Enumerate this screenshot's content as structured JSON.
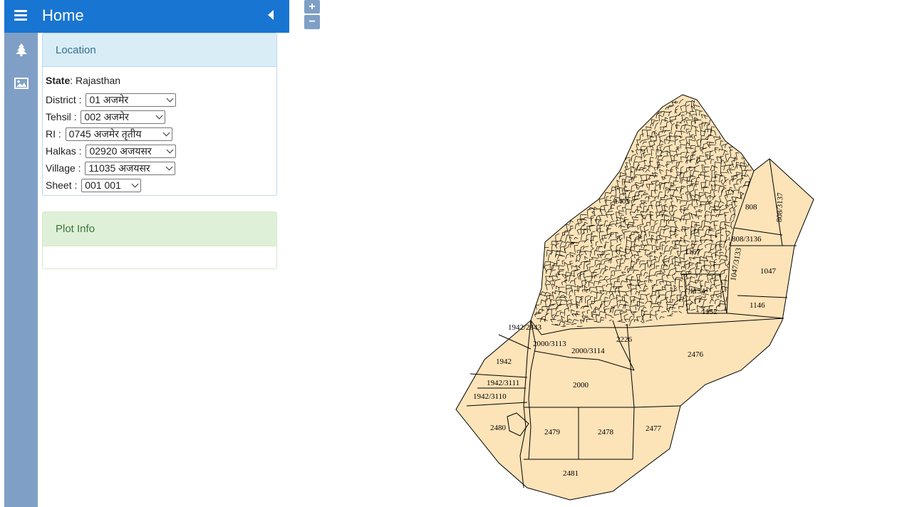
{
  "header": {
    "title": "Home"
  },
  "sidebar_icons": [
    "tree-icon",
    "image-icon"
  ],
  "location": {
    "heading": "Location",
    "state_label": "State",
    "state_value": ": Rajasthan",
    "district": {
      "label": "District : ",
      "value": "01 अजमेर"
    },
    "tehsil": {
      "label": "Tehsil : ",
      "value": "002 अजमेर"
    },
    "ri": {
      "label": "RI : ",
      "value": "0745 अजमेर तृतीय"
    },
    "halkas": {
      "label": "Halkas : ",
      "value": "02920 अजयसर"
    },
    "village": {
      "label": "Village : ",
      "value": "11035 अजयसर"
    },
    "sheet": {
      "label": "Sheet : ",
      "value": "001 001"
    }
  },
  "plot_info": {
    "heading": "Plot Info"
  },
  "zoom": {
    "in": "+",
    "out": "−"
  },
  "colors": {
    "header": "#1875d1",
    "sidebar": "#7f9fc6",
    "parcel_fill": "#fde3b8",
    "parcel_stroke": "#000000"
  },
  "map": {
    "plot_labels": {
      "l808": "808",
      "l808_3137": "808/3137",
      "l808_3136": "808/3136",
      "l1047": "1047",
      "l1047_3133": "1047/3133",
      "l1146": "1146",
      "l1154": "1154",
      "l1152": "1152",
      "l1167": "1167",
      "l1405": "1405",
      "l1942_2843": "1942/2843",
      "l2000_3113": "2000/3113",
      "l2000_3114": "2000/3114",
      "l2226": "2226",
      "l2476": "2476",
      "l1942": "1942",
      "l1942_3111": "1942/3111",
      "l1942_3110": "1942/3110",
      "l2000": "2000",
      "l2480": "2480",
      "l2479": "2479",
      "l2478": "2478",
      "l2477": "2477",
      "l2481": "2481"
    }
  }
}
